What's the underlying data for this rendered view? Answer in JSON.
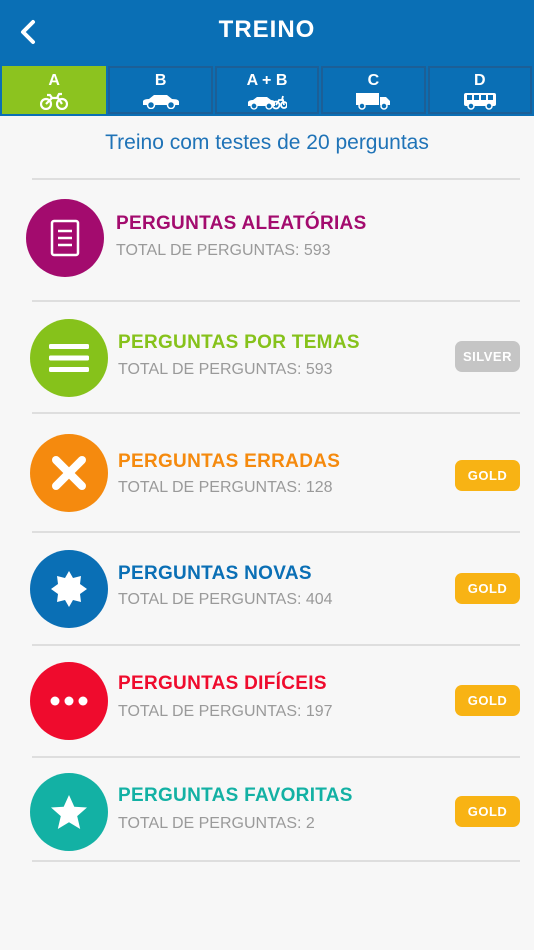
{
  "header": {
    "title": "TREINO"
  },
  "tabs": [
    {
      "label": "A",
      "icon": "motorcycle-icon",
      "active": true
    },
    {
      "label": "B",
      "icon": "car-icon",
      "active": false
    },
    {
      "label": "A + B",
      "icon": "car-motorcycle-icon",
      "active": false
    },
    {
      "label": "C",
      "icon": "truck-icon",
      "active": false
    },
    {
      "label": "D",
      "icon": "bus-icon",
      "active": false
    }
  ],
  "subtitle": "Treino com testes de 20 perguntas",
  "items": [
    {
      "title": "PERGUNTAS ALEATÓRIAS",
      "subtitle": "TOTAL DE PERGUNTAS: 593",
      "icon": "document-icon",
      "color": "#a30b6e",
      "badge": ""
    },
    {
      "title": "PERGUNTAS POR TEMAS",
      "subtitle": "TOTAL DE PERGUNTAS: 593",
      "icon": "list-icon",
      "color": "#86c21b",
      "badge": "SILVER"
    },
    {
      "title": "PERGUNTAS ERRADAS",
      "subtitle": "TOTAL DE PERGUNTAS: 128",
      "icon": "cross-icon",
      "color": "#f58a0e",
      "badge": "GOLD"
    },
    {
      "title": "PERGUNTAS NOVAS",
      "subtitle": "TOTAL DE PERGUNTAS: 404",
      "icon": "starburst-icon",
      "color": "#0a6fb5",
      "badge": "GOLD"
    },
    {
      "title": "PERGUNTAS DIFÍCEIS",
      "subtitle": "TOTAL DE PERGUNTAS: 197",
      "icon": "dots-icon",
      "color": "#ef0b2d",
      "badge": "GOLD"
    },
    {
      "title": "PERGUNTAS FAVORITAS",
      "subtitle": "TOTAL DE PERGUNTAS: 2",
      "icon": "star-icon",
      "color": "#13b1a4",
      "badge": "GOLD"
    }
  ],
  "badge_colors": {
    "SILVER": "#c5c5c5",
    "GOLD": "#f8b314"
  }
}
